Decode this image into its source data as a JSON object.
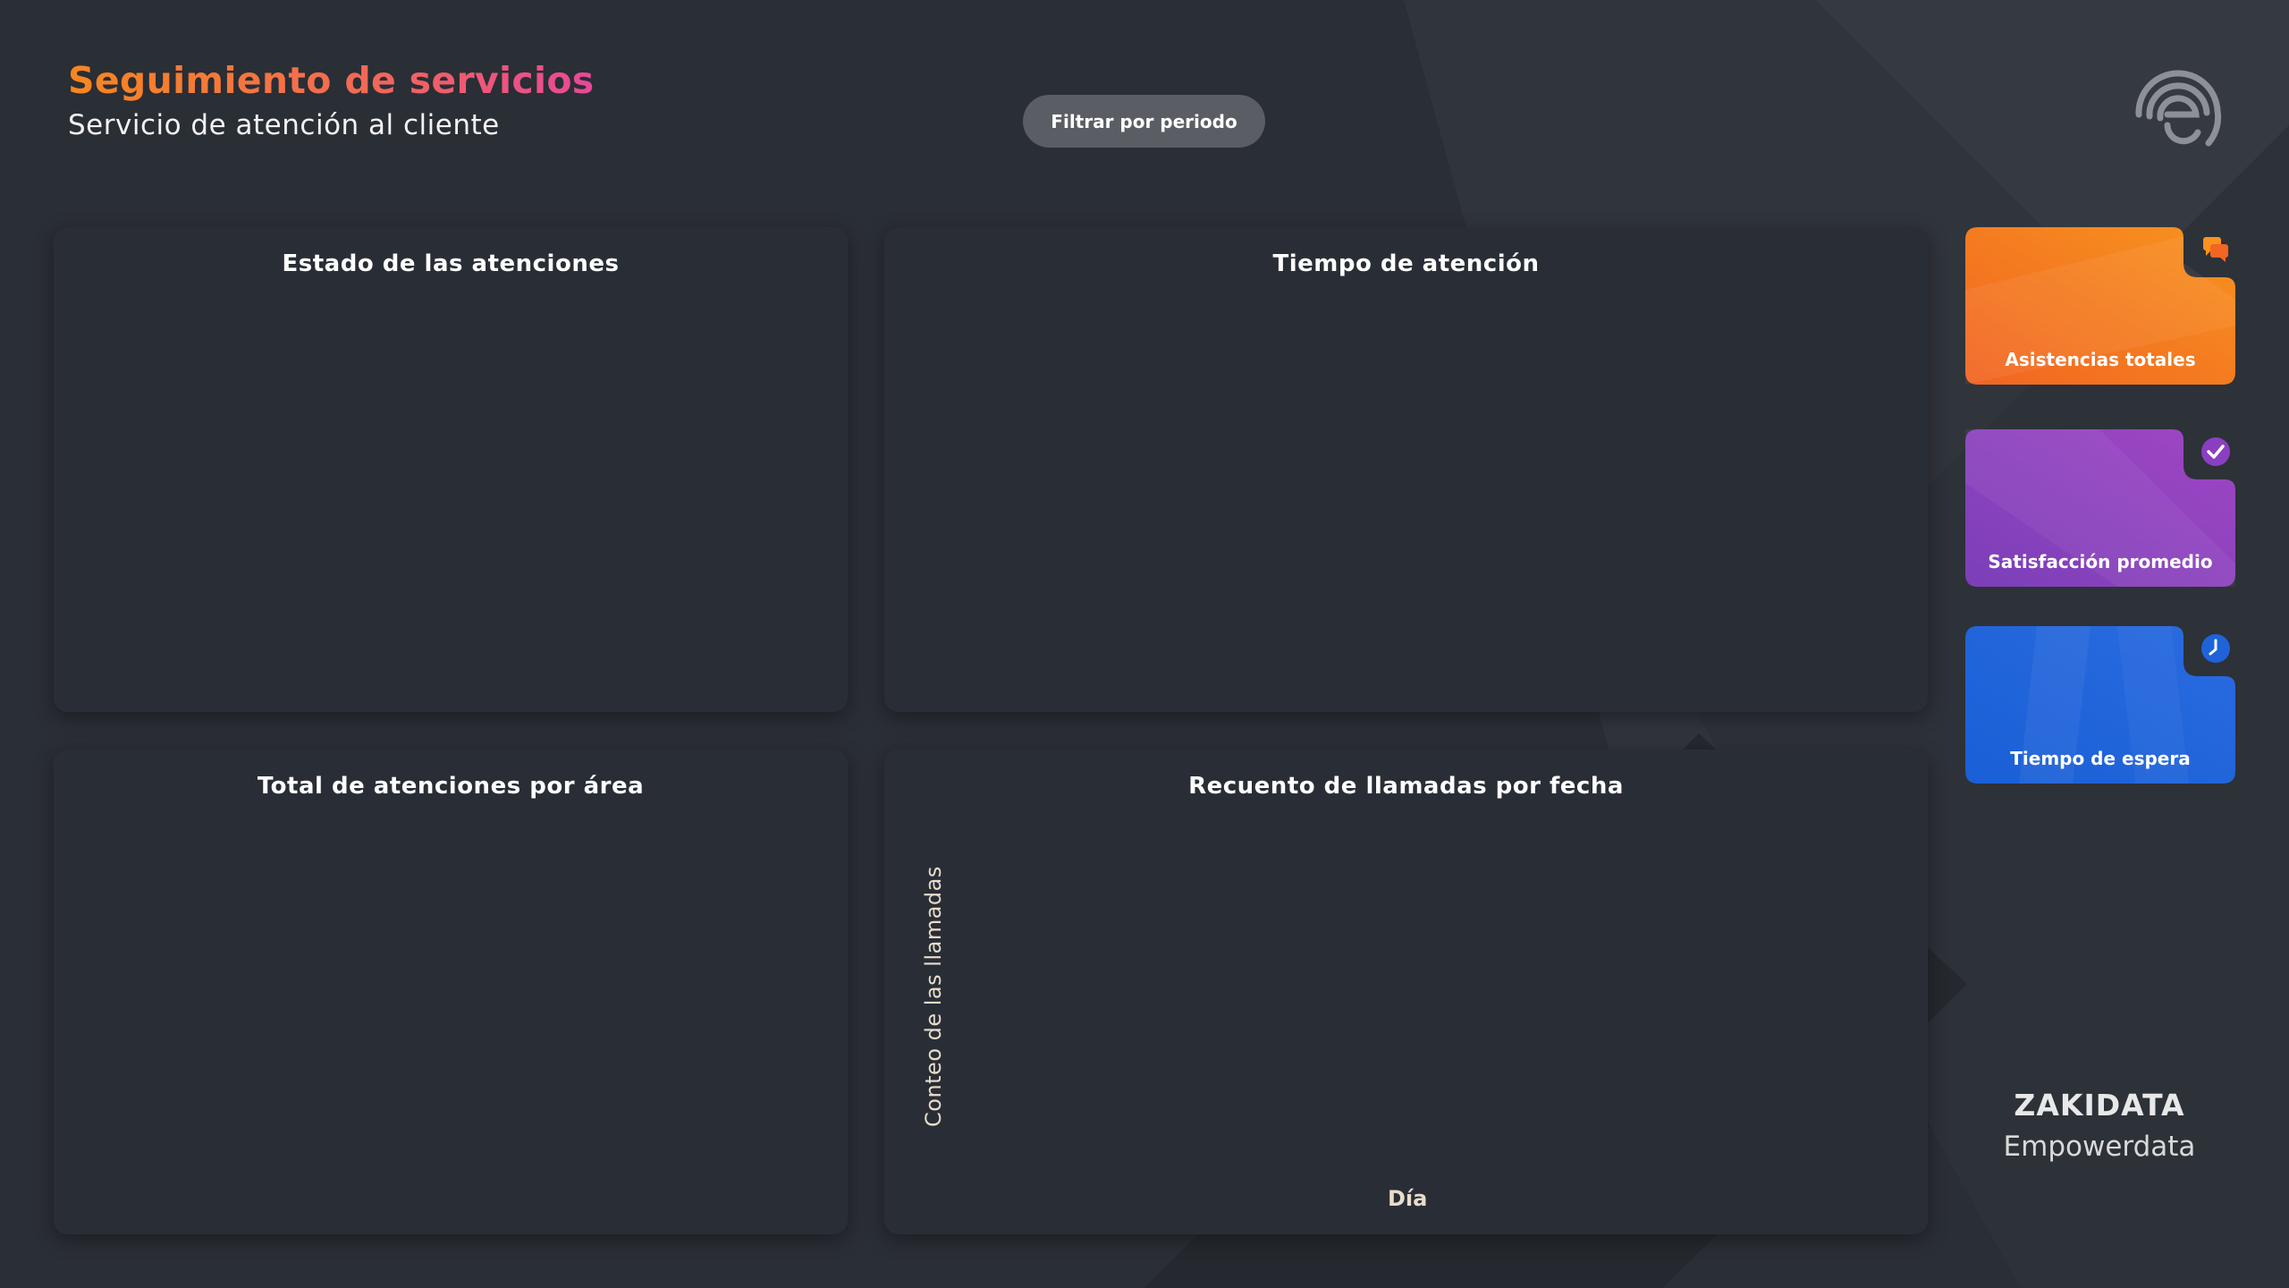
{
  "header": {
    "title": "Seguimiento de servicios",
    "subtitle": "Servicio de atención al cliente"
  },
  "filter_button": {
    "label": "Filtrar por periodo"
  },
  "panels": {
    "estado": {
      "title": "Estado de las atenciones"
    },
    "tiempo": {
      "title": "Tiempo de atención"
    },
    "area": {
      "title": "Total de atenciones por área"
    },
    "llamadas": {
      "title": "Recuento de llamadas por fecha",
      "y_axis_label": "Conteo de las llamadas",
      "x_axis_label": "Día"
    }
  },
  "kpi_cards": [
    {
      "label": "Asistencias totales",
      "icon": "chat-icon",
      "color_start": "#f26522",
      "color_end": "#f7931e"
    },
    {
      "label": "Satisfacción promedio",
      "icon": "check-circle-icon",
      "color_start": "#7b3fb8",
      "color_end": "#a046c4"
    },
    {
      "label": "Tiempo de espera",
      "icon": "clock-icon",
      "color_start": "#1a5fd6",
      "color_end": "#2a6be0"
    }
  ],
  "brand": {
    "name": "ZAKIDATA",
    "tagline": "Empowerdata"
  },
  "colors": {
    "background": "#2a2e35",
    "panel": "#292e36",
    "title_gradient_start": "#f7871e",
    "title_gradient_end": "#e8479a",
    "button": "#5a5e64"
  }
}
